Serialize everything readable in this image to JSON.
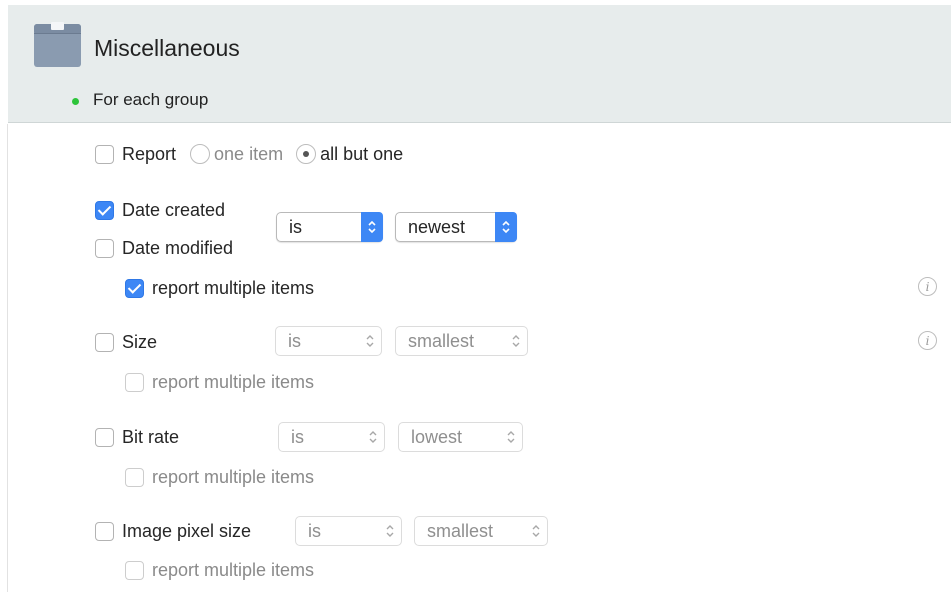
{
  "section": {
    "title": "Miscellaneous",
    "icon": "box-icon",
    "group_label": "For each group",
    "status_color": "#2dc43a"
  },
  "report": {
    "label": "Report",
    "checked": false,
    "options": [
      {
        "label": "one item",
        "selected": false
      },
      {
        "label": "all but one",
        "selected": true
      }
    ]
  },
  "date": {
    "created_label": "Date created",
    "created_checked": true,
    "modified_label": "Date modified",
    "modified_checked": false,
    "operator": "is",
    "value": "newest",
    "report_multiple_label": "report multiple items",
    "report_multiple_checked": true,
    "info_icon": "info-icon"
  },
  "size": {
    "label": "Size",
    "checked": false,
    "operator": "is",
    "value": "smallest",
    "report_multiple_label": "report multiple items",
    "info_icon": "info-icon"
  },
  "bitrate": {
    "label": "Bit rate",
    "checked": false,
    "operator": "is",
    "value": "lowest",
    "report_multiple_label": "report multiple items"
  },
  "pixel": {
    "label": "Image pixel size",
    "checked": false,
    "operator": "is",
    "value": "smallest",
    "report_multiple_label": "report multiple items"
  },
  "colors": {
    "accent": "#3d87f5",
    "header_bg": "#e7ecec"
  }
}
